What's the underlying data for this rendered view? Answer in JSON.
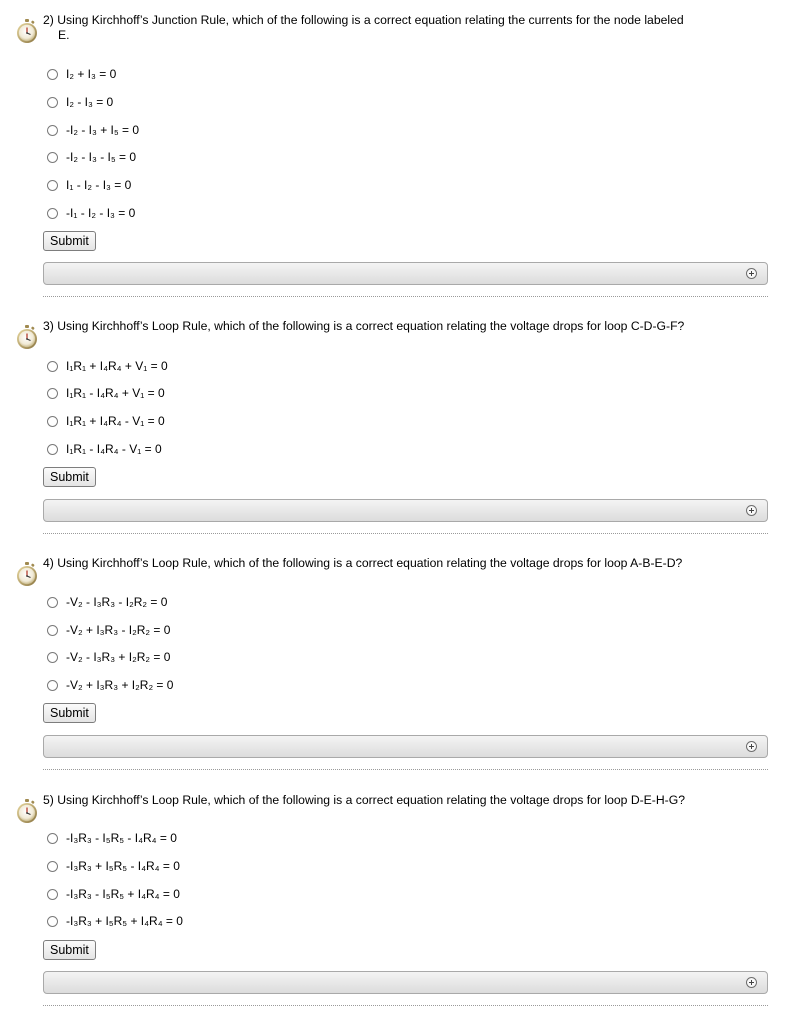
{
  "questions": [
    {
      "number": "2)",
      "text_line1": "2) Using Kirchhoff’s Junction Rule, which of the following is a correct equation relating the currents for the node labeled",
      "text_line2": "E.",
      "options": [
        "I₂ + I₃ = 0",
        "I₂ - I₃ = 0",
        "-I₂ - I₃ + I₅ = 0",
        "-I₂ - I₃ - I₅ = 0",
        "I₁ - I₂ - I₃ = 0",
        "-I₁ - I₂ - I₃ = 0"
      ],
      "submit_label": "Submit"
    },
    {
      "number": "3)",
      "text_line1": "3) Using Kirchhoff’s Loop Rule, which of the following is a correct equation relating the voltage drops for loop C-D-G-F?",
      "text_line2": "",
      "options": [
        "I₁R₁ + I₄R₄ + V₁ = 0",
        "I₁R₁ - I₄R₄ + V₁ = 0",
        "I₁R₁ + I₄R₄ - V₁ = 0",
        "I₁R₁ - I₄R₄ - V₁ = 0"
      ],
      "submit_label": "Submit"
    },
    {
      "number": "4)",
      "text_line1": "4) Using Kirchhoff’s Loop Rule, which of the following is a correct equation relating the voltage drops for loop A-B-E-D?",
      "text_line2": "",
      "options": [
        "-V₂ - I₃R₃ - I₂R₂ = 0",
        "-V₂ + I₃R₃ - I₂R₂ = 0",
        "-V₂ - I₃R₃ + I₂R₂ = 0",
        "-V₂ + I₃R₃ + I₂R₂ = 0"
      ],
      "submit_label": "Submit"
    },
    {
      "number": "5)",
      "text_line1": "5) Using Kirchhoff’s Loop Rule, which of the following is a correct equation relating the voltage drops for loop D-E-H-G?",
      "text_line2": "",
      "options": [
        "-I₃R₃ - I₅R₅ - I₄R₄ = 0",
        "-I₃R₃ + I₅R₅ - I₄R₄ = 0",
        "-I₃R₃ - I₅R₅ + I₄R₄ = 0",
        "-I₃R₃ + I₅R₅ + I₄R₄ = 0"
      ],
      "submit_label": "Submit"
    }
  ],
  "icons": {
    "question_icon": "stopwatch-icon",
    "expand_icon": "plus-circle-icon"
  },
  "colors": {
    "feedback_bar_top": "#f4f4f4",
    "feedback_bar_bottom": "#dcdcdc",
    "border": "#a9a9a9",
    "divider": "#9a9a9a"
  }
}
